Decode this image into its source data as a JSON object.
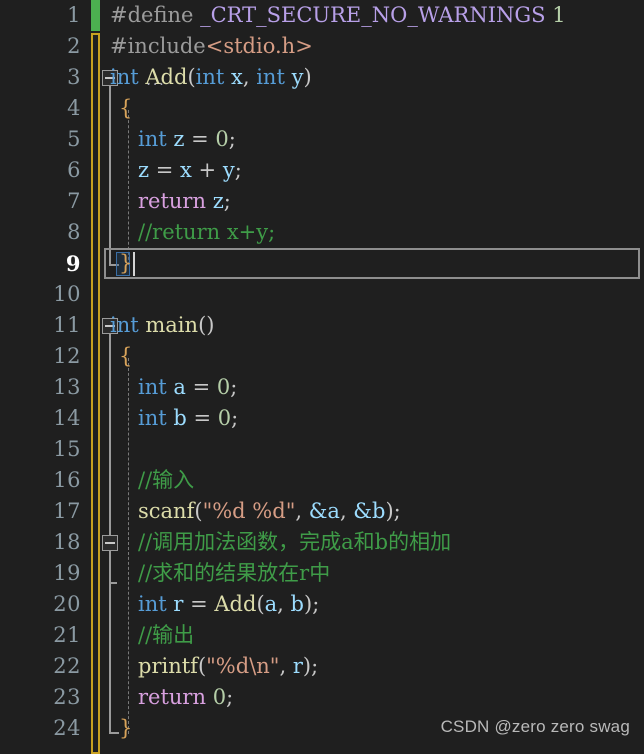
{
  "editor": {
    "background": "#1f1f1f",
    "gutter_background": "#1f1f1f",
    "current_line": 9,
    "total_lines": 24,
    "line_height_px": 31,
    "change_bar_saved_color": "#4caf50",
    "change_bar_unsaved_color": "#c8a020"
  },
  "line_numbers": [
    "1",
    "2",
    "3",
    "4",
    "5",
    "6",
    "7",
    "8",
    "9",
    "10",
    "11",
    "12",
    "13",
    "14",
    "15",
    "16",
    "17",
    "18",
    "19",
    "20",
    "21",
    "22",
    "23",
    "24"
  ],
  "code_lines": [
    {
      "n": 1,
      "text": "#define _CRT_SECURE_NO_WARNINGS 1"
    },
    {
      "n": 2,
      "text": "#include<stdio.h>"
    },
    {
      "n": 3,
      "text": "int Add(int x, int y)"
    },
    {
      "n": 4,
      "text": "{"
    },
    {
      "n": 5,
      "text": "    int z = 0;"
    },
    {
      "n": 6,
      "text": "    z = x + y;"
    },
    {
      "n": 7,
      "text": "    return z;"
    },
    {
      "n": 8,
      "text": "    //return x+y;"
    },
    {
      "n": 9,
      "text": "}"
    },
    {
      "n": 10,
      "text": ""
    },
    {
      "n": 11,
      "text": "int main()"
    },
    {
      "n": 12,
      "text": "{"
    },
    {
      "n": 13,
      "text": "    int a = 0;"
    },
    {
      "n": 14,
      "text": "    int b = 0;"
    },
    {
      "n": 15,
      "text": ""
    },
    {
      "n": 16,
      "text": "    //输入"
    },
    {
      "n": 17,
      "text": "    scanf(\"%d %d\", &a, &b);"
    },
    {
      "n": 18,
      "text": "    //调用加法函数，完成a和b的相加"
    },
    {
      "n": 19,
      "text": "    //求和的结果放在r中"
    },
    {
      "n": 20,
      "text": "    int r = Add(a, b);"
    },
    {
      "n": 21,
      "text": "    //输出"
    },
    {
      "n": 22,
      "text": "    printf(\"%d\\n\", r);"
    },
    {
      "n": 23,
      "text": "    return 0;"
    },
    {
      "n": 24,
      "text": "}"
    }
  ],
  "tokens": {
    "hash_define": "#define",
    "macro_name": " _CRT_SECURE_NO_WARNINGS ",
    "macro_value": "1",
    "hash_include": "#include",
    "include_open": "<",
    "include_header": "stdio.h",
    "include_close": ">",
    "kw_int": "int",
    "fn_add": "Add",
    "fn_main": "main",
    "fn_scanf": "scanf",
    "fn_printf": "printf",
    "kw_return": "return",
    "var_x": "x",
    "var_y": "y",
    "var_z": "z",
    "var_a": "a",
    "var_b": "b",
    "var_r": "r",
    "num_zero": "0",
    "brace_open": "{",
    "brace_close": "}",
    "paren_open": "(",
    "paren_close": ")",
    "comma_space": ", ",
    "semicolon": ";",
    "eq": " = ",
    "plus": " + ",
    "str_scanf": "\"%d %d\"",
    "str_printf": "\"%d\\n\"",
    "amp_a": "&a",
    "amp_b": "&b",
    "cmt_return_xy": "//return x+y;",
    "cmt_input": "//输入",
    "cmt_call_add": "//调用加法函数，完成a和b的相加",
    "cmt_result_in_r": "//求和的结果放在r中",
    "cmt_output": "//输出",
    "space": " "
  },
  "fold_markers": [
    {
      "line": 3,
      "state": "expanded",
      "glyph": "minus-box"
    },
    {
      "line": 11,
      "state": "expanded",
      "glyph": "minus-box"
    },
    {
      "line": 18,
      "state": "expanded",
      "glyph": "minus-box"
    }
  ],
  "watermark": {
    "text": "CSDN @zero zero swag"
  },
  "colors": {
    "keyword": "#569cd6",
    "control": "#d8a0df",
    "function": "#dcdcaa",
    "variable": "#9cdcfe",
    "number": "#b5cea8",
    "string": "#d69d85",
    "comment": "#3f9c48",
    "macro": "#b8a0e8",
    "punctuation": "#c8c8c8",
    "brace": "#d8a35a"
  }
}
